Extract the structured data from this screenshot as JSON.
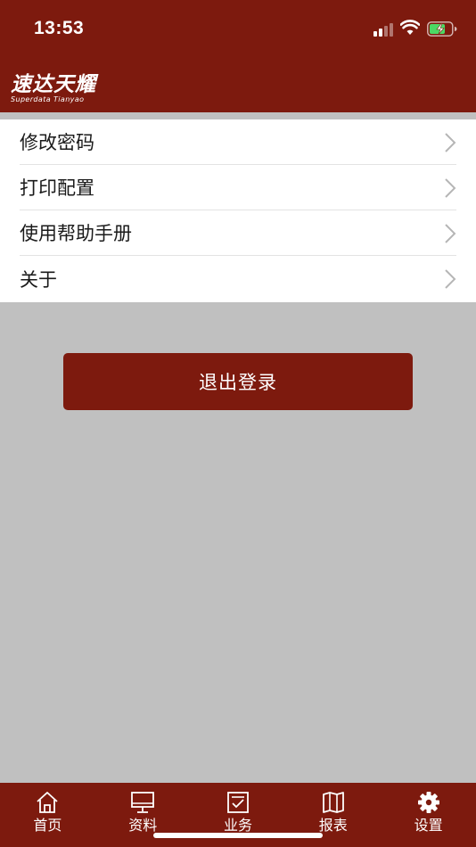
{
  "status_bar": {
    "time": "13:53"
  },
  "header": {
    "logo_text": "速达天耀",
    "logo_subtitle": "Superdata Tianyao"
  },
  "menu": {
    "items": [
      {
        "label": "修改密码"
      },
      {
        "label": "打印配置"
      },
      {
        "label": "使用帮助手册"
      },
      {
        "label": "关于"
      }
    ]
  },
  "logout": {
    "label": "退出登录"
  },
  "tabbar": {
    "tabs": [
      {
        "label": "首页",
        "icon": "home-icon"
      },
      {
        "label": "资料",
        "icon": "monitor-icon"
      },
      {
        "label": "业务",
        "icon": "checklist-icon"
      },
      {
        "label": "报表",
        "icon": "map-icon"
      },
      {
        "label": "设置",
        "icon": "gear-icon"
      }
    ]
  },
  "colors": {
    "brand": "#7d1a0e",
    "background": "#c0c0c0",
    "battery_charge": "#4cd964"
  }
}
